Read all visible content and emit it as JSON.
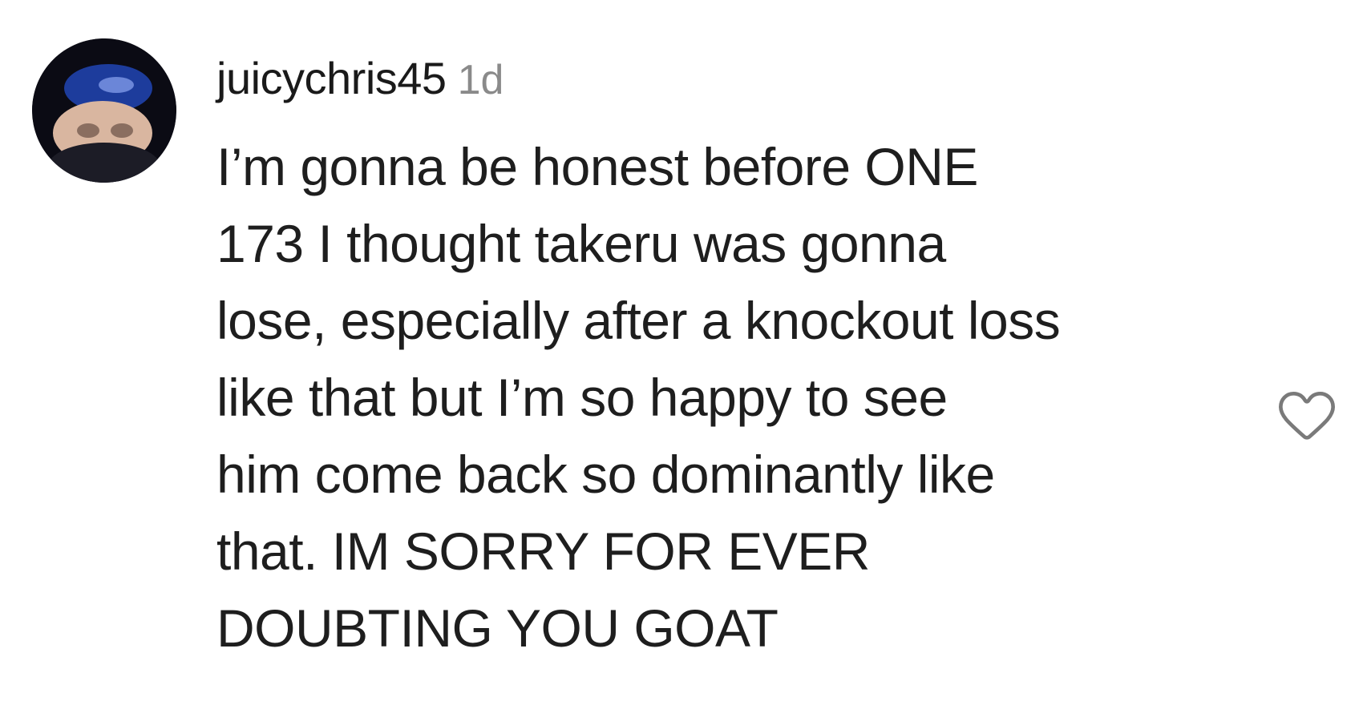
{
  "comment": {
    "username": "juicychris45",
    "timestamp": "1d",
    "text_lines": [
      "I’m gonna be honest before ONE",
      "173 I thought takeru was gonna",
      "lose, especially after a knockout loss",
      "like that but I’m so happy to see",
      "him come back so dominantly like",
      "that. IM SORRY FOR EVER",
      "DOUBTING YOU GOAT"
    ],
    "like_icon": "heart-outline-icon",
    "avatar_icon": "user-avatar"
  }
}
